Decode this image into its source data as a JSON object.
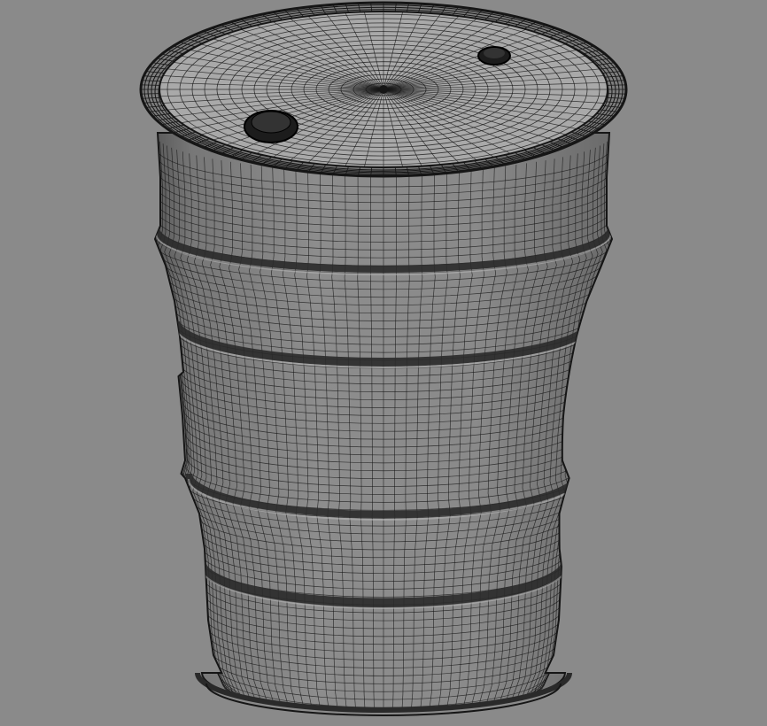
{
  "scene": {
    "background": "#8a8a8a",
    "shaded_fill": "#8f8f8f",
    "wire_color": "#161616",
    "rim_dark": "#2a2a2a",
    "object": "barrel-wireframe-render"
  }
}
